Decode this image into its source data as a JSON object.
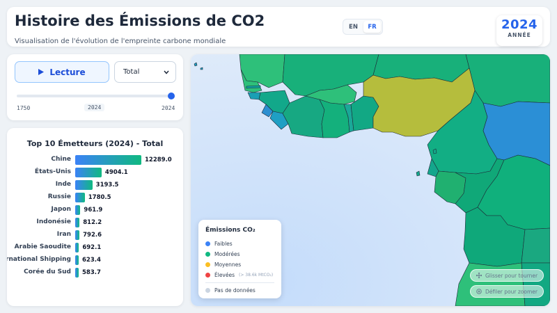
{
  "header": {
    "title": "Histoire des Émissions de CO2",
    "subtitle": "Visualisation de l'évolution de l'empreinte carbone mondiale",
    "languages": [
      {
        "code": "EN",
        "active": false
      },
      {
        "code": "FR",
        "active": true
      }
    ],
    "year": "2024",
    "year_label": "ANNÉE"
  },
  "controls": {
    "play_label": "Lecture",
    "play_icon": "play-icon",
    "select_value": "Total",
    "slider": {
      "min_label": "1750",
      "current_label": "2024",
      "max_label": "2024",
      "min": 1750,
      "max": 2024,
      "value": 2024
    }
  },
  "ranking": {
    "title": "Top 10 Émetteurs (2024) - Total",
    "max_value": 12289.0,
    "items": [
      {
        "name": "Chine",
        "value": "12289.0"
      },
      {
        "name": "États-Unis",
        "value": "4904.1"
      },
      {
        "name": "Inde",
        "value": "3193.5"
      },
      {
        "name": "Russie",
        "value": "1780.5"
      },
      {
        "name": "Japon",
        "value": "961.9"
      },
      {
        "name": "Indonésie",
        "value": "812.2"
      },
      {
        "name": "Iran",
        "value": "792.6"
      },
      {
        "name": "Arabie Saoudite",
        "value": "692.1"
      },
      {
        "name": "International Shipping",
        "value": "623.4"
      },
      {
        "name": "Corée du Sud",
        "value": "583.7"
      }
    ]
  },
  "legend": {
    "title": "Émissions CO₂",
    "items": [
      {
        "label": "Faibles",
        "color": "#3b82f6",
        "note": ""
      },
      {
        "label": "Modérées",
        "color": "#10b981",
        "note": ""
      },
      {
        "label": "Moyennes",
        "color": "#fbbf24",
        "note": ""
      },
      {
        "label": "Élevées",
        "color": "#ef4444",
        "note": "(> 38.6k MtCO₂)"
      },
      {
        "label": "Pas de données",
        "color": "#cbd5e1",
        "note": ""
      }
    ]
  },
  "map_hints": {
    "drag": "Glisser pour tourner",
    "zoom": "Défiler pour zoomer"
  },
  "colors": {
    "accent": "#2563eb",
    "ocean": "#d6e6fb",
    "low": "#3b82f6",
    "moderate": "#10b981",
    "medium_dark": "#b5bd3d"
  }
}
